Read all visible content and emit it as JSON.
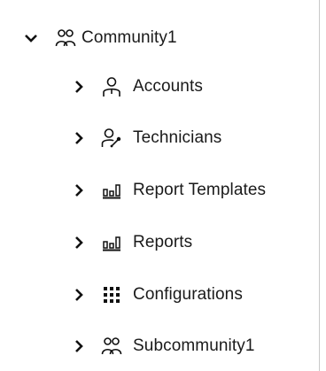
{
  "tree": {
    "root": {
      "label": "Community1",
      "expanded": true,
      "icon": "community-icon"
    },
    "children": [
      {
        "label": "Accounts",
        "icon": "account-user-icon",
        "expanded": false
      },
      {
        "label": "Technicians",
        "icon": "technician-icon",
        "expanded": false
      },
      {
        "label": "Report Templates",
        "icon": "report-chart-icon",
        "expanded": false
      },
      {
        "label": "Reports",
        "icon": "report-chart-icon",
        "expanded": false
      },
      {
        "label": "Configurations",
        "icon": "grid-dots-icon",
        "expanded": false
      },
      {
        "label": "Subcommunity1",
        "icon": "community-icon",
        "expanded": false
      }
    ]
  }
}
